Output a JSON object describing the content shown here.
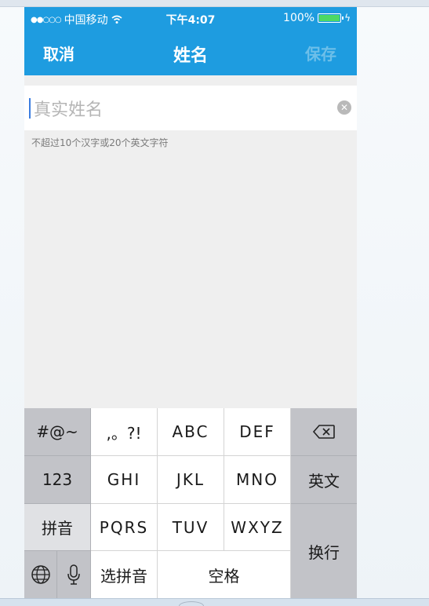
{
  "status_bar": {
    "signal": "●●○○○",
    "carrier": "中国移动",
    "wifi_icon": "wifi-icon",
    "time": "下午4:07",
    "battery": "100%",
    "bolt": "ϟ"
  },
  "navbar": {
    "cancel": "取消",
    "title": "姓名",
    "save": "保存"
  },
  "form": {
    "placeholder": "真实姓名",
    "hint": "不超过10个汉字或20个英文字符",
    "clear_icon": "✕"
  },
  "keyboard": {
    "symbols": "#@~",
    "punct": ",。?!",
    "abc": "ABC",
    "def": "DEF",
    "backspace": "⌫",
    "num": "123",
    "ghi": "GHI",
    "jkl": "JKL",
    "mno": "MNO",
    "english": "英文",
    "pinyin": "拼音",
    "pqrs": "PQRS",
    "tuv": "TUV",
    "wxyz": "WXYZ",
    "return": "换行",
    "globe": "🌐",
    "mic": "🎙",
    "select_pinyin": "选拼音",
    "space": "空格"
  }
}
